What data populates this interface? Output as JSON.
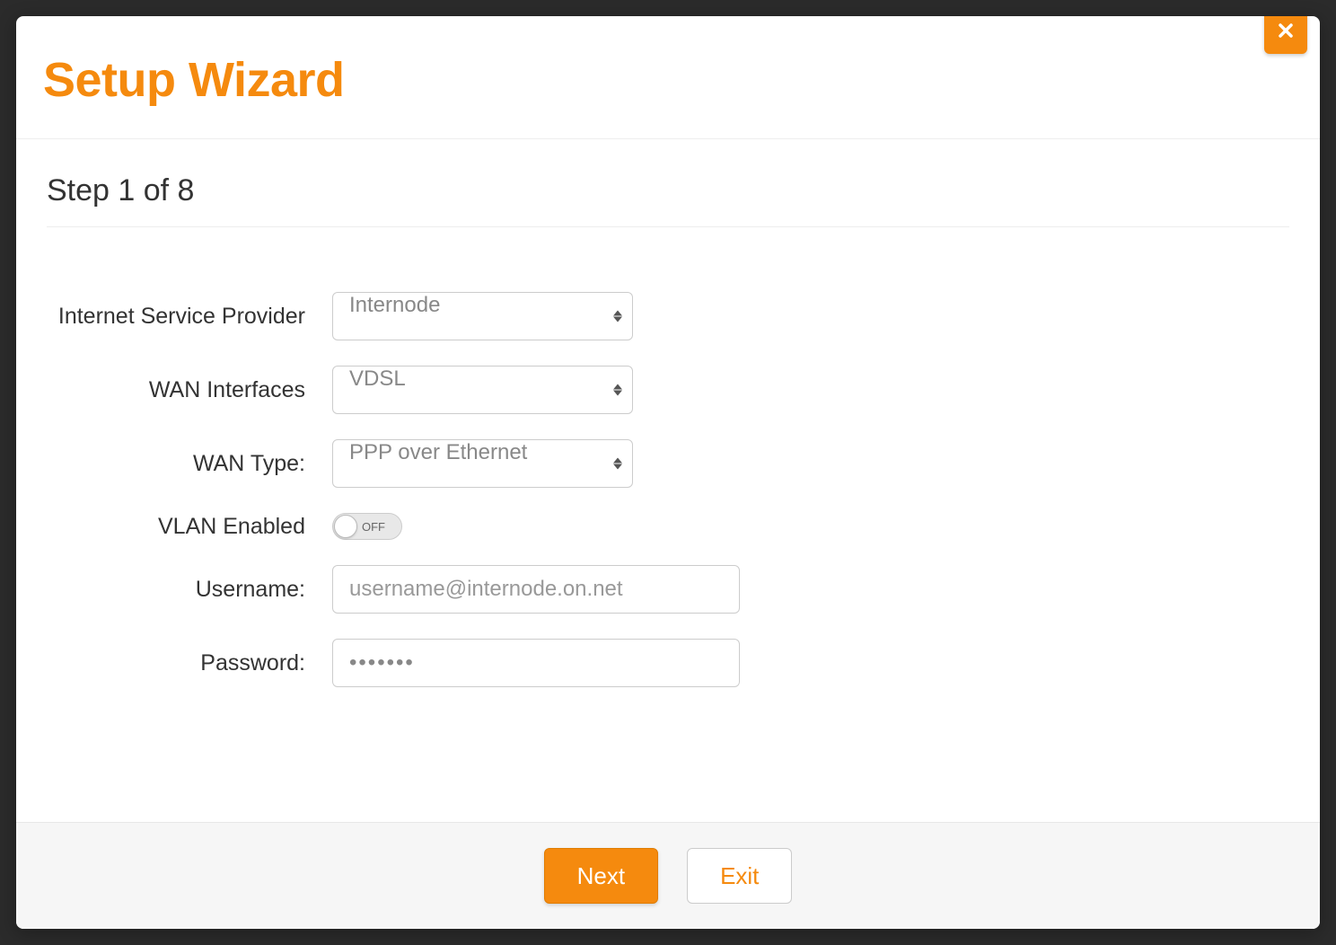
{
  "modal": {
    "title": "Setup Wizard",
    "step_label": "Step 1 of 8"
  },
  "form": {
    "isp": {
      "label": "Internet Service Provider",
      "value": "Internode"
    },
    "wan_interfaces": {
      "label": "WAN Interfaces",
      "value": "VDSL"
    },
    "wan_type": {
      "label": "WAN Type:",
      "value": "PPP over Ethernet"
    },
    "vlan": {
      "label": "VLAN Enabled",
      "state_text": "OFF",
      "enabled": false
    },
    "username": {
      "label": "Username:",
      "placeholder": "username@internode.on.net",
      "value": ""
    },
    "password": {
      "label": "Password:",
      "value": "•••••••"
    }
  },
  "footer": {
    "next": "Next",
    "exit": "Exit"
  },
  "colors": {
    "accent": "#f58a0e"
  }
}
